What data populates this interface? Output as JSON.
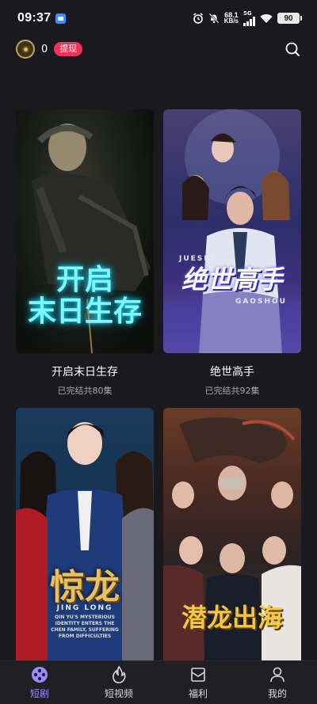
{
  "status_bar": {
    "time": "09:37",
    "net_speed_value": "68.1",
    "net_speed_unit": "KB/s",
    "signal_label": "5G",
    "battery": "90"
  },
  "header": {
    "coin_count": "0",
    "withdraw_label": "提现"
  },
  "dramas": [
    {
      "title": "开启末日生存",
      "subtitle": "已完结共80集",
      "poster_text": "开启\n末日生存"
    },
    {
      "title": "绝世高手",
      "subtitle": "已完结共92集",
      "poster_text": "绝世高手"
    },
    {
      "title": "惊龙",
      "subtitle": "",
      "poster_text": "惊龙"
    },
    {
      "title": "潜龙出海",
      "subtitle": "",
      "poster_text": "潜龙出海"
    }
  ],
  "poster_logos": {
    "p1_line1": "开启",
    "p1_line2": "末日生存",
    "p2_top": "JUESHI",
    "p2_main": "绝世高手",
    "p2_bottom": "GAOSHOU",
    "p3_main": "惊龙",
    "p3_en": "JING LONG",
    "p3_tag1": "QIN YU'S MYSTERIOUS",
    "p3_tag2": "IDENTITY ENTERS THE",
    "p3_tag3": "CHEN FAMILY, SUFFERING",
    "p3_tag4": "FROM DIFFICULTIES",
    "p4_main1": "潜",
    "p4_main2": "龙",
    "p4_main3": "出",
    "p4_main4": "海"
  },
  "bottom_nav": [
    {
      "label": "短剧",
      "icon": "film-reel-icon",
      "active": true
    },
    {
      "label": "短视频",
      "icon": "flame-icon",
      "active": false
    },
    {
      "label": "福利",
      "icon": "gift-box-icon",
      "active": false
    },
    {
      "label": "我的",
      "icon": "person-icon",
      "active": false
    }
  ],
  "colors": {
    "background": "#1a1a1e",
    "accent": "#9b8cff",
    "withdraw": "#f0325a"
  }
}
